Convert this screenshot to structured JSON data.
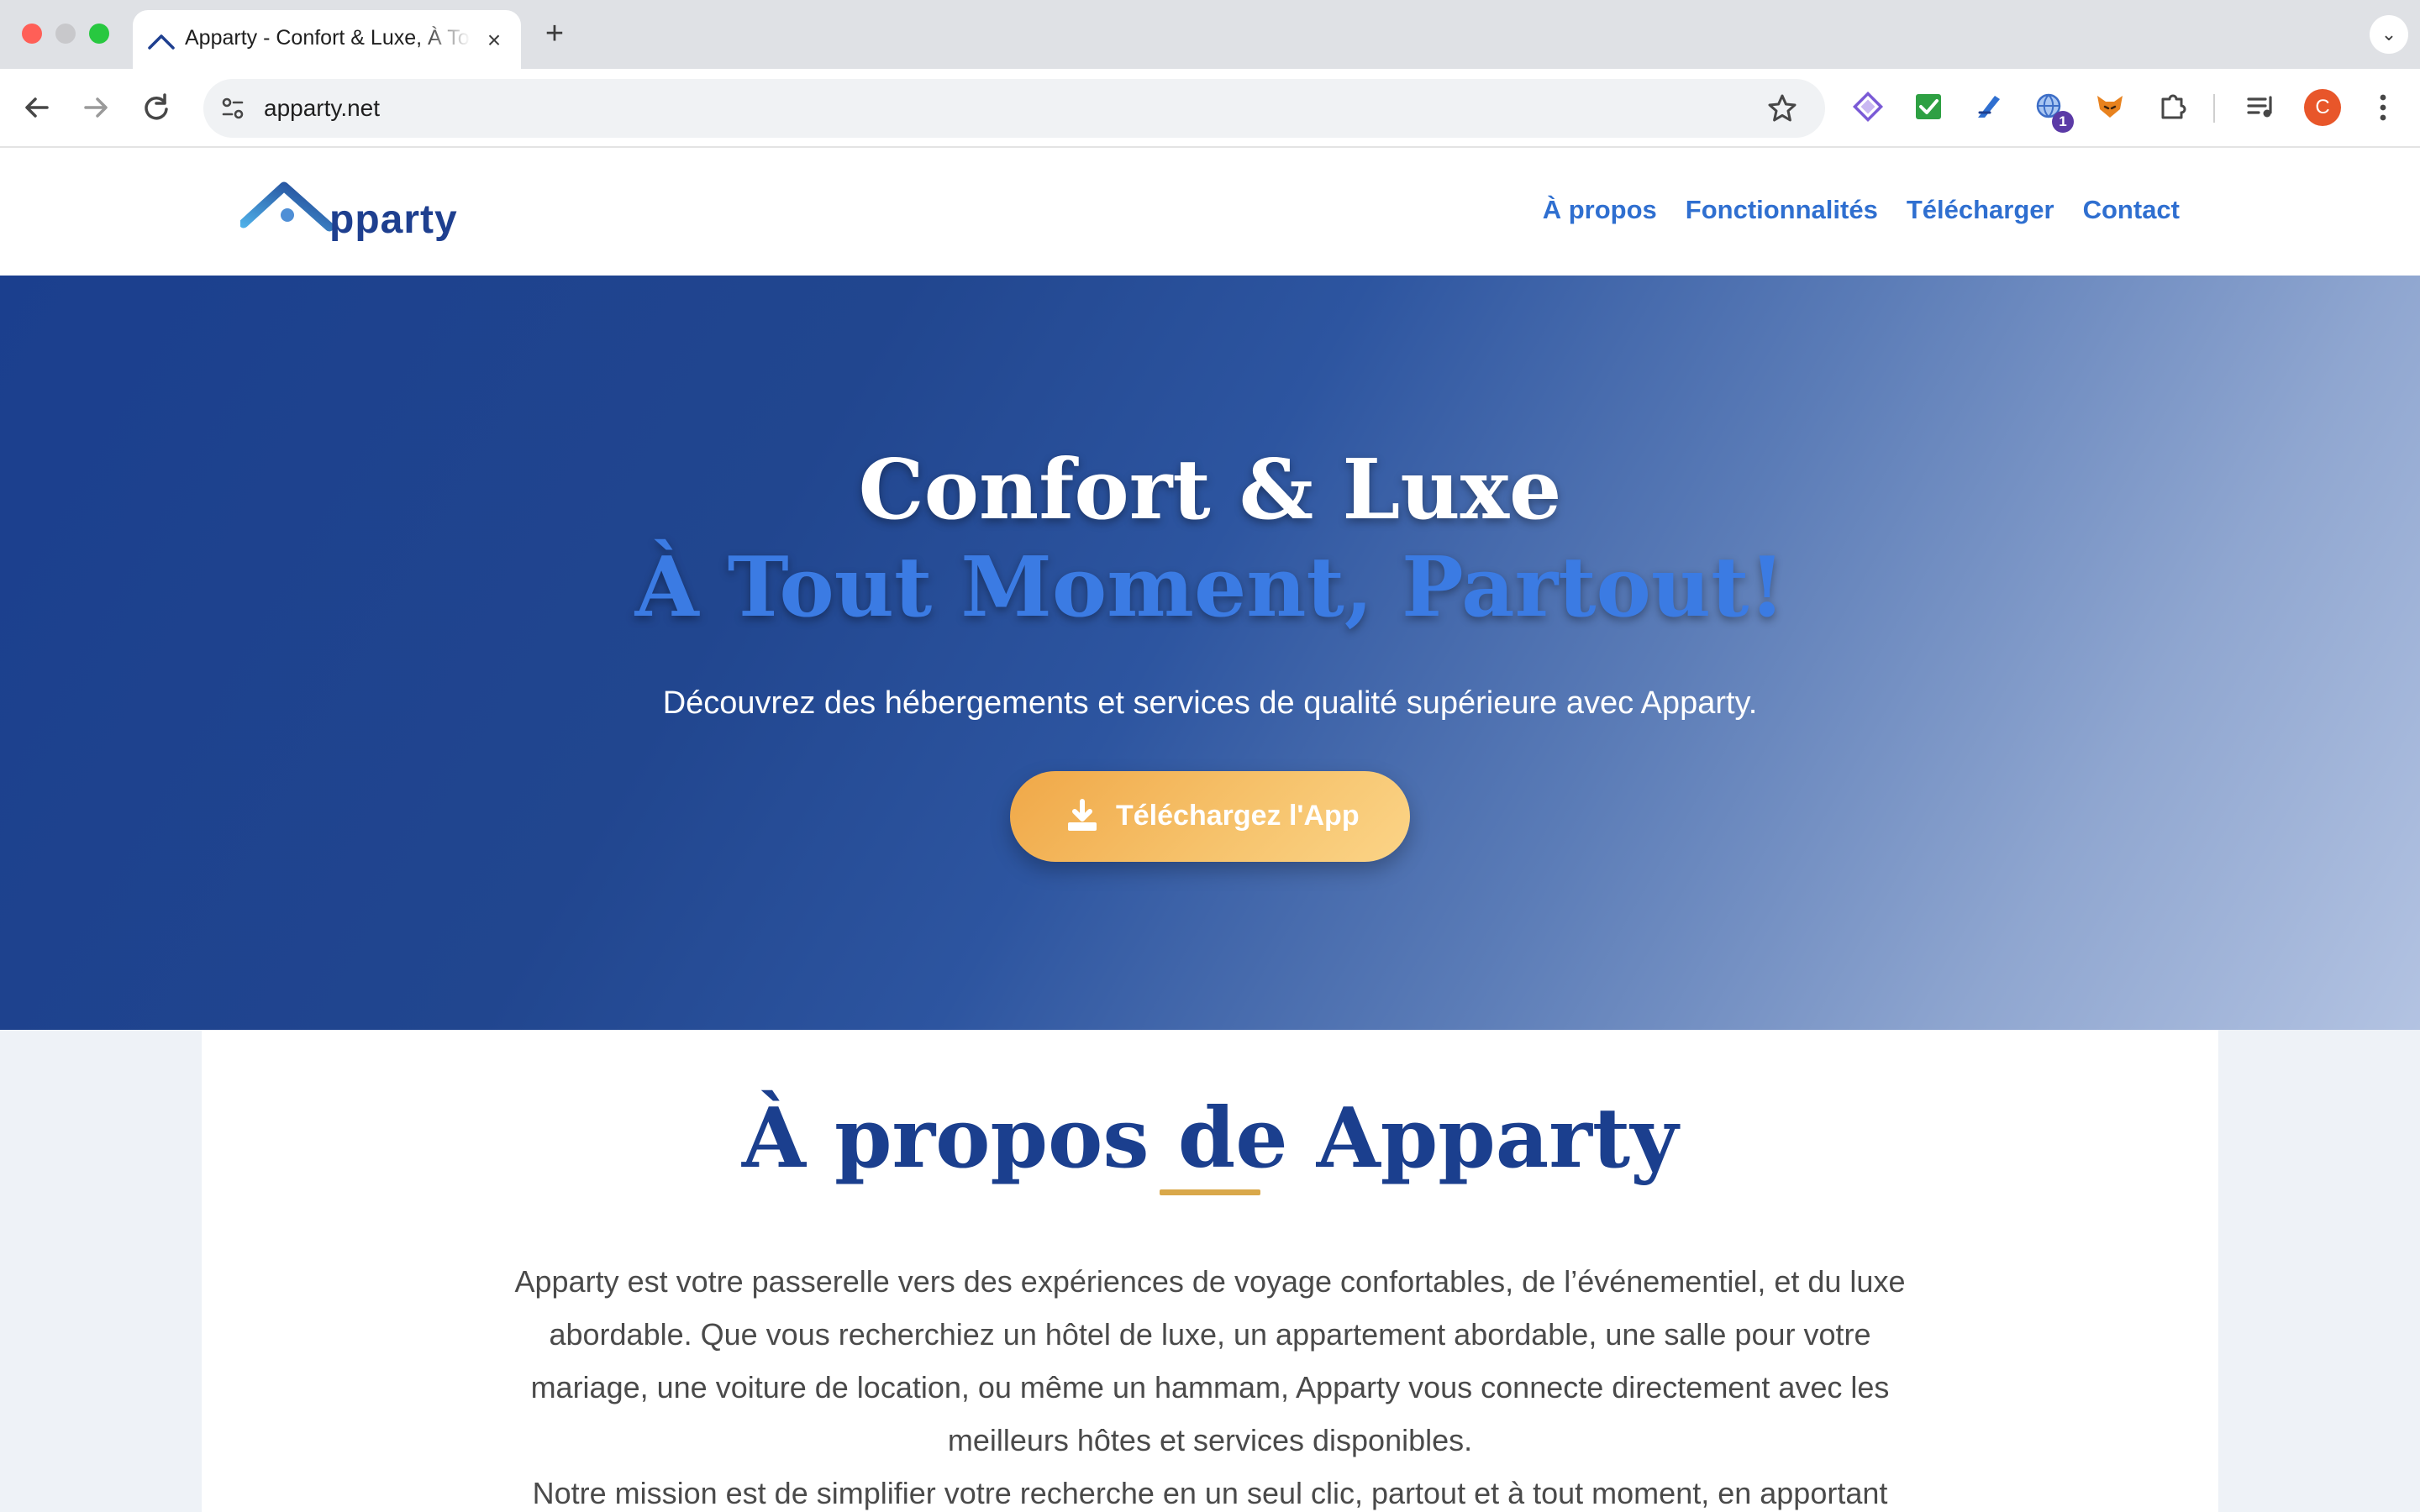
{
  "browser": {
    "tab_title": "Apparty - Confort & Luxe, À Tout Moment, Partout!",
    "tab_close": "×",
    "new_tab": "+",
    "tab_menu": "⌄",
    "url": "apparty.net",
    "avatar_letter": "C",
    "extension_badge": "1",
    "icons": {
      "back": "back-arrow-icon",
      "forward": "forward-arrow-icon",
      "reload": "reload-icon",
      "site_info": "site-settings-icon",
      "bookmark": "star-icon",
      "menu": "kebab-menu-icon"
    }
  },
  "site": {
    "logo_text": "pparty",
    "nav": [
      "À propos",
      "Fonctionnalités",
      "Télécharger",
      "Contact"
    ],
    "accent_color": "#2f6fd0",
    "brand_color": "#1b3f8e",
    "cta_color": "#f6c26b"
  },
  "hero": {
    "title_line1": "Confort & Luxe",
    "title_line2": "À Tout Moment, Partout!",
    "subtitle": "Découvrez des hébergements et services de qualité supérieure avec Apparty.",
    "cta_label": "Téléchargez l'App",
    "cta_icon": "download-icon"
  },
  "about": {
    "title": "À propos de Apparty",
    "paragraph1": "Apparty est votre passerelle vers des expériences de voyage confortables, de l’événementiel, et du luxe abordable. Que vous recherchiez un hôtel de luxe, un appartement abordable, une salle pour votre mariage, une voiture de location, ou même un hammam, Apparty vous connecte directement avec les meilleurs hôtes et services disponibles.",
    "paragraph2": "Notre mission est de simplifier votre recherche en un seul clic, partout et à tout moment, en apportant"
  }
}
